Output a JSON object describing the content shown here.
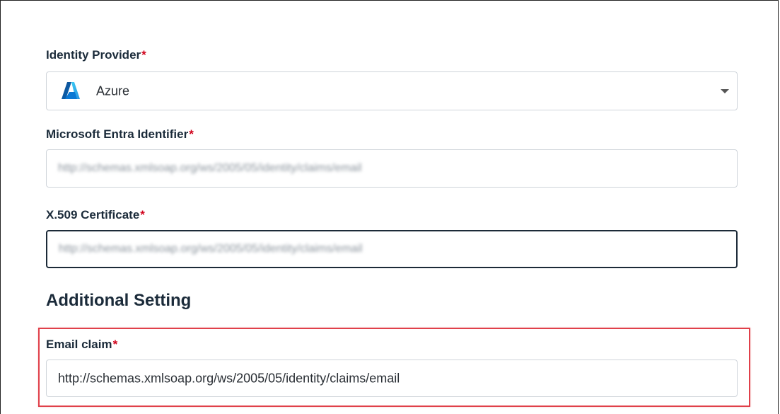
{
  "identity_provider": {
    "label": "Identity Provider",
    "required_mark": "*",
    "selected_value": "Azure",
    "icon": "azure-logo-icon"
  },
  "entra_identifier": {
    "label": "Microsoft Entra Identifier",
    "required_mark": "*",
    "value": "http://schemas.xmlsoap.org/ws/2005/05/identity/claims/email"
  },
  "certificate": {
    "label": "X.509 Certificate",
    "required_mark": "*",
    "value": "http://schemas.xmlsoap.org/ws/2005/05/identity/claims/email"
  },
  "additional": {
    "title": "Additional Setting"
  },
  "email_claim": {
    "label": "Email claim",
    "required_mark": "*",
    "value": "http://schemas.xmlsoap.org/ws/2005/05/identity/claims/email"
  },
  "colors": {
    "required": "#d0021b",
    "highlight": "#e0404a",
    "azure_blue": "#0a78d4"
  }
}
